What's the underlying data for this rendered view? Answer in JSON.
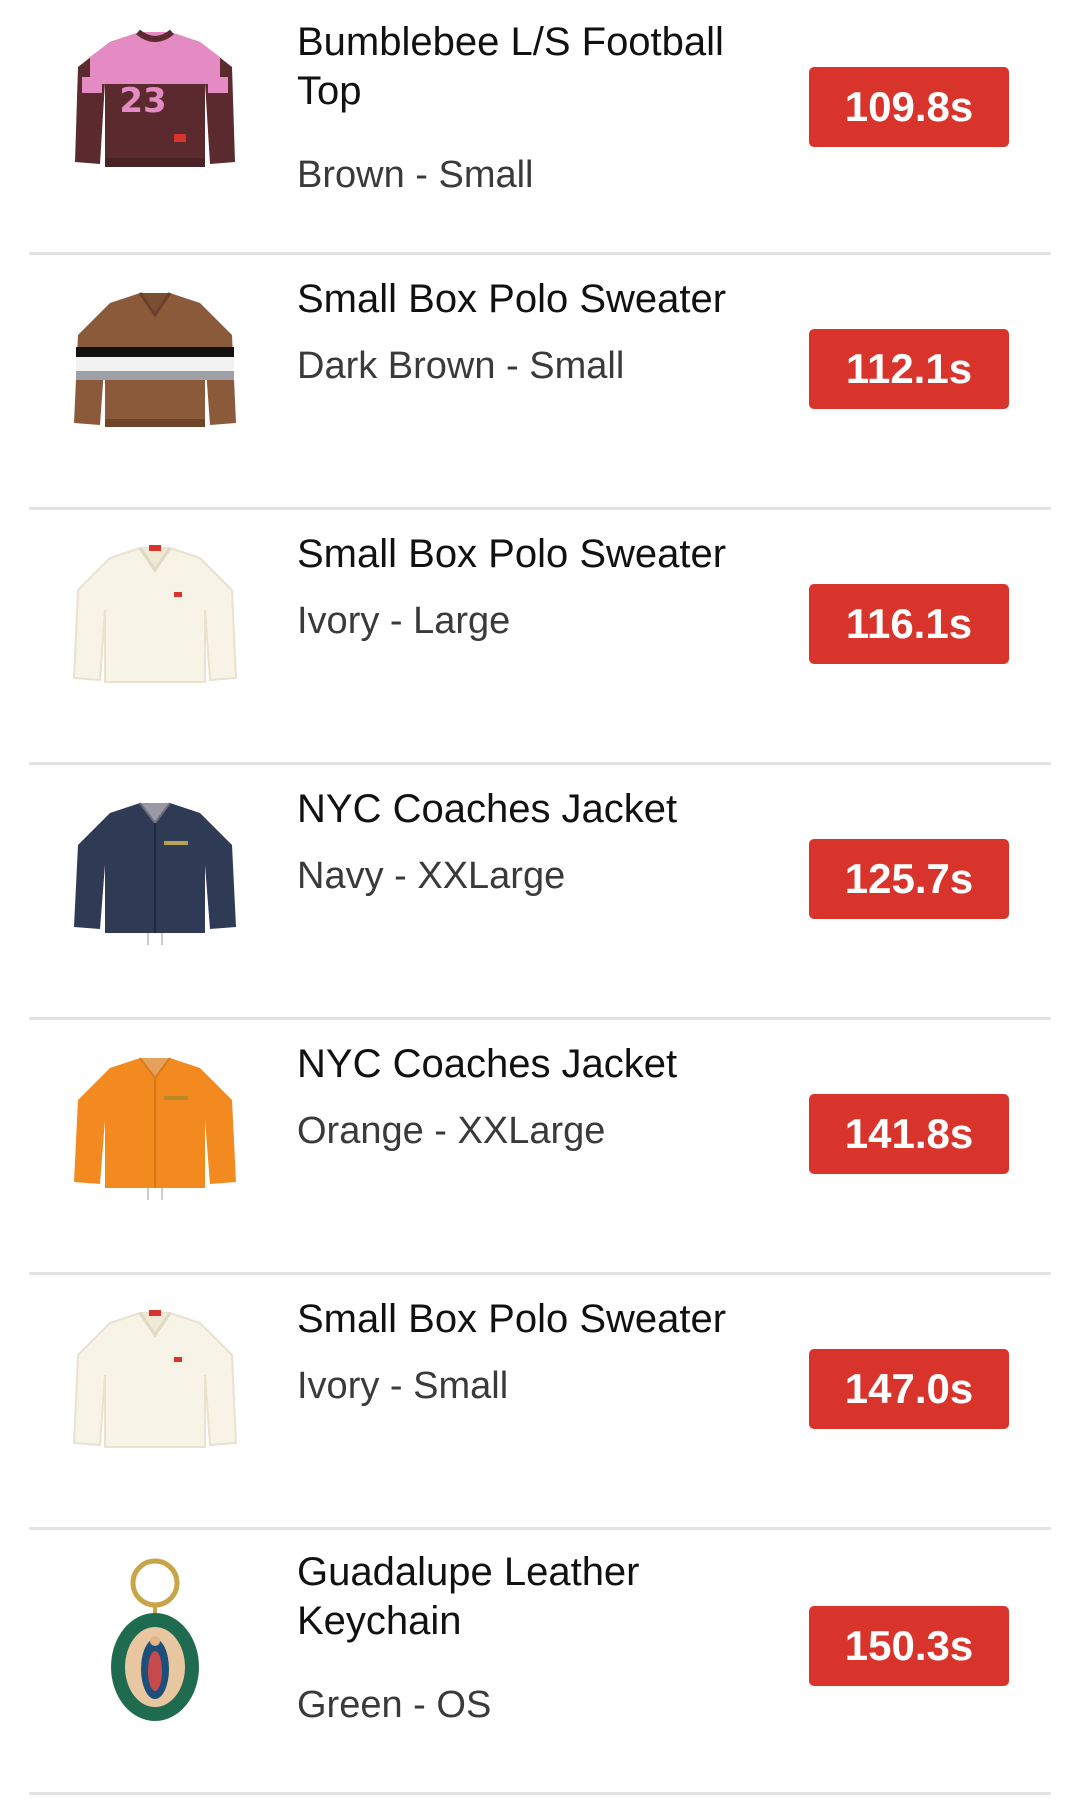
{
  "items": [
    {
      "title": "Bumblebee L/S Football Top",
      "variant": "Brown - Small",
      "price": "109.8s",
      "image": "brown-football-top-icon"
    },
    {
      "title": "Small Box Polo Sweater",
      "variant": "Dark Brown - Small",
      "price": "112.1s",
      "image": "brown-striped-sweater-icon"
    },
    {
      "title": "Small Box Polo Sweater",
      "variant": "Ivory - Large",
      "price": "116.1s",
      "image": "ivory-sweater-icon"
    },
    {
      "title": "NYC Coaches Jacket",
      "variant": "Navy - XXLarge",
      "price": "125.7s",
      "image": "navy-jacket-icon"
    },
    {
      "title": "NYC Coaches Jacket",
      "variant": "Orange - XXLarge",
      "price": "141.8s",
      "image": "orange-jacket-icon"
    },
    {
      "title": "Small Box Polo Sweater",
      "variant": "Ivory - Small",
      "price": "147.0s",
      "image": "ivory-sweater-icon"
    },
    {
      "title": "Guadalupe Leather Keychain",
      "variant": "Green - OS",
      "price": "150.3s",
      "image": "green-keychain-icon"
    }
  ],
  "colors": {
    "price_badge": "#d8342b",
    "divider": "#e3e3e3",
    "title_text": "#111111",
    "variant_text": "#3a3a3a"
  }
}
